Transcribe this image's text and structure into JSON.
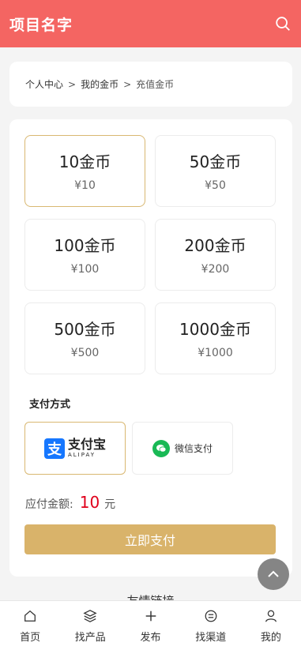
{
  "header": {
    "title": "项目名字",
    "search_icon": "search-icon"
  },
  "breadcrumb": {
    "items": [
      "个人中心",
      "我的金币",
      "充值金币"
    ],
    "separator": ">"
  },
  "packages": [
    {
      "coins": "10金币",
      "price": "¥10",
      "selected": true
    },
    {
      "coins": "50金币",
      "price": "¥50",
      "selected": false
    },
    {
      "coins": "100金币",
      "price": "¥100",
      "selected": false
    },
    {
      "coins": "200金币",
      "price": "¥200",
      "selected": false
    },
    {
      "coins": "500金币",
      "price": "¥500",
      "selected": false
    },
    {
      "coins": "1000金币",
      "price": "¥1000",
      "selected": false
    }
  ],
  "payment": {
    "title": "支付方式",
    "alipay": {
      "cn": "支付宝",
      "en": "ALIPAY",
      "mark": "支",
      "selected": true
    },
    "wechat": {
      "label": "微信支付",
      "selected": false
    }
  },
  "amount": {
    "label": "应付金额:",
    "value": "10",
    "unit": "元"
  },
  "pay_button": "立即支付",
  "links_title": "友情链接",
  "tabbar": [
    {
      "label": "首页",
      "icon": "home-icon"
    },
    {
      "label": "找产品",
      "icon": "layers-icon"
    },
    {
      "label": "发布",
      "icon": "plus-icon"
    },
    {
      "label": "找渠道",
      "icon": "channel-icon"
    },
    {
      "label": "我的",
      "icon": "user-icon"
    }
  ],
  "colors": {
    "header": "#f46562",
    "accent": "#d9b36a",
    "selected_border": "#d9b872",
    "price_red": "#e0001b",
    "alipay": "#1677ff",
    "wechat": "#19b955"
  }
}
